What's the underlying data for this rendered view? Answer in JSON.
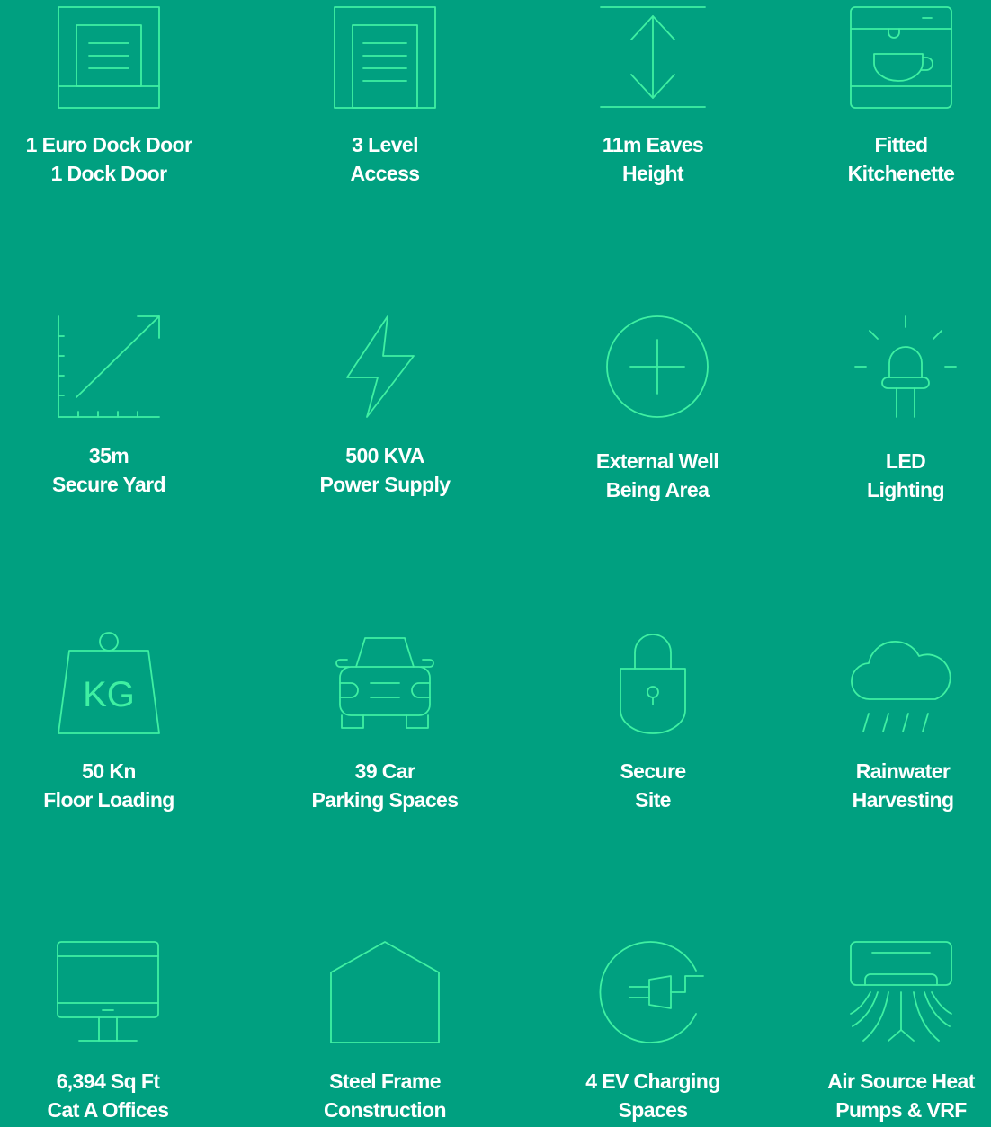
{
  "features": [
    {
      "line1": "1 Euro Dock Door",
      "line2": "1 Dock Door",
      "icon": "dock-door-icon"
    },
    {
      "line1": "3 Level",
      "line2": "Access",
      "icon": "level-access-door-icon"
    },
    {
      "line1": "11m Eaves",
      "line2": "Height",
      "icon": "height-arrow-icon"
    },
    {
      "line1": "Fitted",
      "line2": "Kitchenette",
      "icon": "coffee-machine-icon"
    },
    {
      "line1": "35m",
      "line2": "Secure Yard",
      "icon": "yard-diagonal-arrow-icon"
    },
    {
      "line1": "500 KVA",
      "line2": "Power Supply",
      "icon": "lightning-bolt-icon"
    },
    {
      "line1": "External Well",
      "line2": "Being Area",
      "icon": "plus-circle-icon"
    },
    {
      "line1": "LED",
      "line2": "Lighting",
      "icon": "led-bulb-icon"
    },
    {
      "line1": "50 Kn",
      "line2": "Floor Loading",
      "icon": "kg-weight-icon"
    },
    {
      "line1": "39 Car",
      "line2": "Parking Spaces",
      "icon": "car-icon"
    },
    {
      "line1": "Secure",
      "line2": "Site",
      "icon": "padlock-icon"
    },
    {
      "line1": "Rainwater",
      "line2": "Harvesting",
      "icon": "rain-cloud-icon"
    },
    {
      "line1": "6,394 Sq Ft",
      "line2": "Cat A Offices",
      "icon": "monitor-icon"
    },
    {
      "line1": "Steel Frame",
      "line2": "Construction",
      "icon": "house-frame-icon"
    },
    {
      "line1": "4 EV Charging",
      "line2": "Spaces",
      "icon": "ev-plug-icon"
    },
    {
      "line1": "Air Source Heat",
      "line2": "Pumps & VRF",
      "icon": "air-conditioner-icon"
    }
  ],
  "icon_text": {
    "kg": "KG"
  },
  "colors": {
    "background": "#00A080",
    "icon": "#3FF0A2",
    "text": "#FFFFFF"
  }
}
